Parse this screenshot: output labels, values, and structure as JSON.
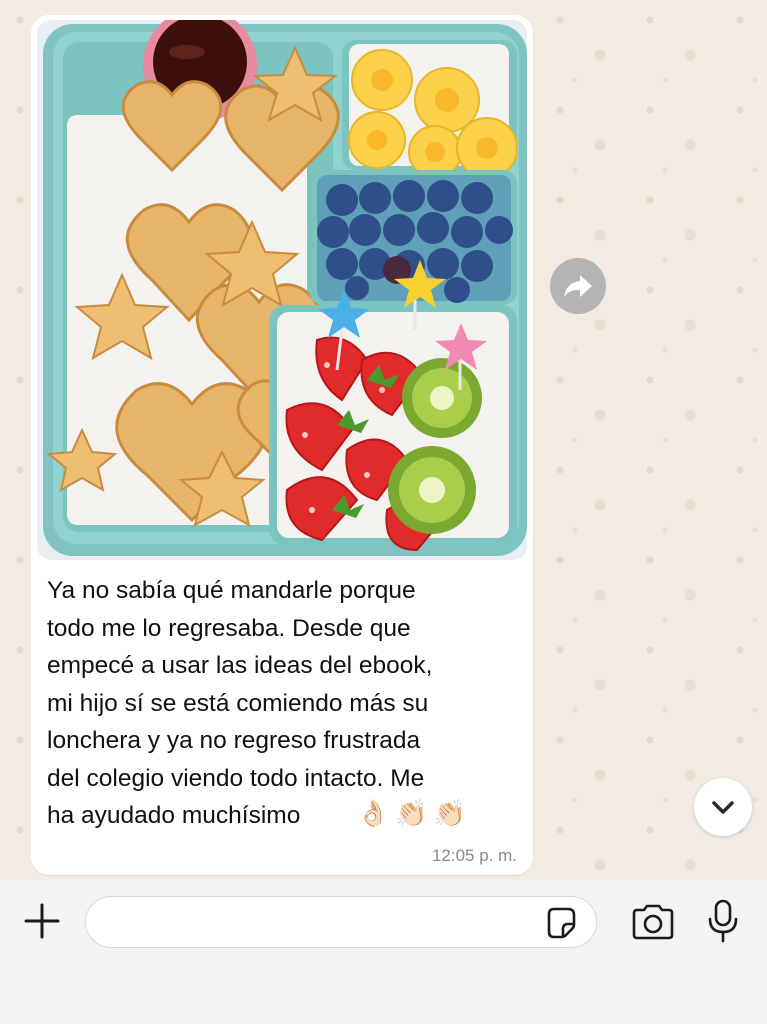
{
  "message": {
    "text": "Ya no sabía qué mandarle porque\ntodo me lo regresaba. Desde que\nempecé a usar las ideas del ebook,\nmi hijo sí se está comiendo más su\nlonchera y ya no regreso frustrada\ndel colegio viendo todo intacto. Me\nha ayudado muchísimo",
    "emojis": [
      "👌🏻",
      "👏🏻",
      "👏🏻"
    ],
    "time": "12:05 p. m."
  },
  "photo": {
    "subject": "lunchbox-photo"
  },
  "composer": {
    "placeholder": ""
  },
  "colors": {
    "chat_background": "#f1ebe2",
    "bubble": "#ffffff",
    "timestamp": "#8a8a8a",
    "composer_bar": "#f3f3f3"
  },
  "icons": {
    "forward": "forward-icon",
    "scroll_down": "chevron-down-icon",
    "attach": "plus-icon",
    "sticker": "sticker-icon",
    "camera": "camera-icon",
    "mic": "microphone-icon"
  }
}
